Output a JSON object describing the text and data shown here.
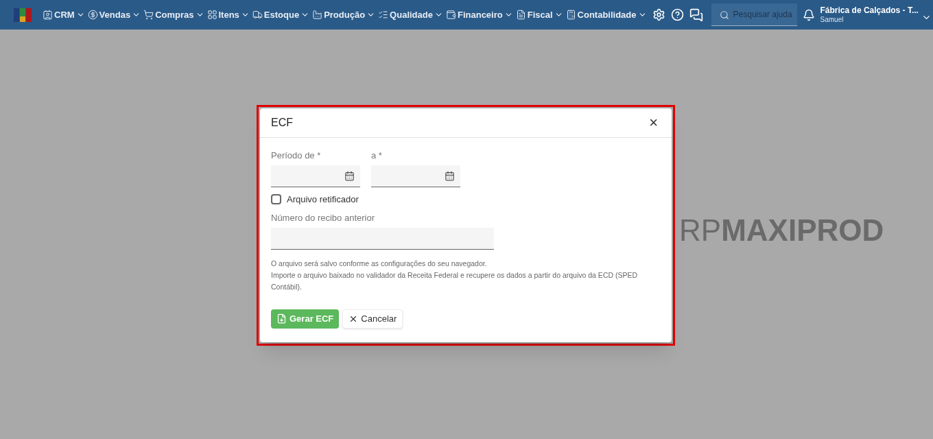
{
  "nav": {
    "menus": [
      {
        "label": "CRM"
      },
      {
        "label": "Vendas"
      },
      {
        "label": "Compras"
      },
      {
        "label": "Itens"
      },
      {
        "label": "Estoque"
      },
      {
        "label": "Produção"
      },
      {
        "label": "Qualidade"
      },
      {
        "label": "Financeiro"
      },
      {
        "label": "Fiscal"
      },
      {
        "label": "Contabilidade"
      }
    ],
    "search": {
      "placeholder": "Pesquisar ajuda"
    },
    "company": "Fábrica de Calçados - T...",
    "user": "Samuel"
  },
  "background_logo": {
    "light": "RP",
    "bold": "MAXIPROD"
  },
  "dialog": {
    "title": "ECF",
    "close": "×",
    "period_from": {
      "label": "Período de *"
    },
    "period_to": {
      "label": "a *"
    },
    "rectifier": {
      "label": "Arquivo retificador",
      "checked": false
    },
    "receipt": {
      "label": "Número do recibo anterior"
    },
    "notes": [
      "O arquivo será salvo conforme as configurações do seu navegador.",
      "Importe o arquivo baixado no validador da Receita Federal e recupere os dados a partir do arquivo da ECD (SPED Contábil)."
    ],
    "buttons": [
      {
        "label": "Gerar ECF",
        "kind": "primary"
      },
      {
        "label": "Cancelar",
        "kind": "secondary"
      }
    ]
  }
}
